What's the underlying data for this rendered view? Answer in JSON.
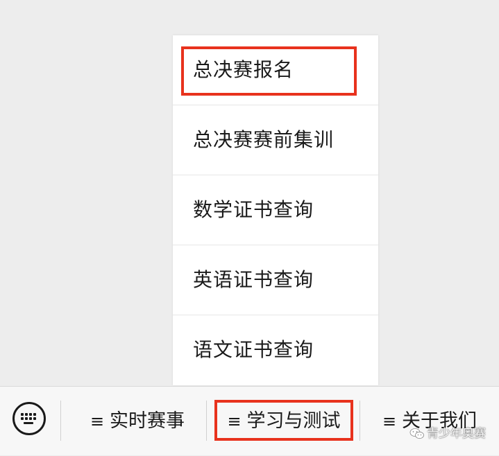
{
  "menu": {
    "items": [
      {
        "label": "总决赛报名",
        "highlighted": true
      },
      {
        "label": "总决赛赛前集训",
        "highlighted": false
      },
      {
        "label": "数学证书查询",
        "highlighted": false
      },
      {
        "label": "英语证书查询",
        "highlighted": false
      },
      {
        "label": "语文证书查询",
        "highlighted": false
      }
    ]
  },
  "bottom_bar": {
    "keyboard_icon": "keyboard-icon",
    "menu_glyph": "≡",
    "tabs": [
      {
        "label": "实时赛事"
      },
      {
        "label": "学习与测试",
        "highlighted": true
      },
      {
        "label": "关于我们"
      }
    ]
  },
  "watermark": {
    "text": "青少年奥赛",
    "icon": "wechat-icon"
  },
  "colors": {
    "highlight": "#e8321d",
    "background": "#ededed",
    "menu_background": "#ffffff",
    "text": "#1a1a1a"
  }
}
